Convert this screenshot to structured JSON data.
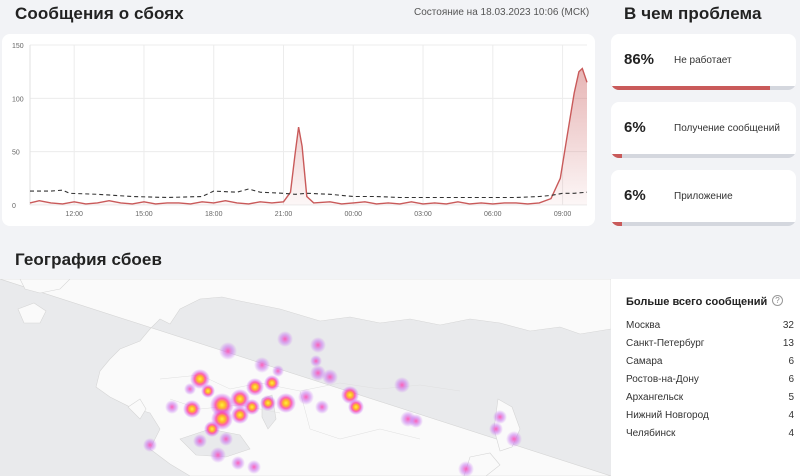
{
  "header": {
    "reports_title": "Сообщения о сбоях",
    "status_text": "Состояние на 18.03.2023 10:06 (МСК)",
    "problem_title": "В чем проблема",
    "geo_title": "География сбоев"
  },
  "chart_data": {
    "type": "line",
    "x_tick_labels": [
      "12:00",
      "15:00",
      "18:00",
      "21:00",
      "00:00",
      "03:00",
      "06:00",
      "09:00"
    ],
    "y_tick_labels": [
      "0",
      "50",
      "100",
      "150"
    ],
    "ylim": [
      0,
      150
    ],
    "x_start_hour": 10.1,
    "x_end_hour": 34.05,
    "series": [
      {
        "style": "solid-area",
        "color": "#c95a5a",
        "points": [
          [
            10.1,
            2
          ],
          [
            10.5,
            4
          ],
          [
            11,
            2
          ],
          [
            11.5,
            1
          ],
          [
            12,
            3
          ],
          [
            12.5,
            1
          ],
          [
            13,
            2
          ],
          [
            13.5,
            4
          ],
          [
            14,
            2
          ],
          [
            14.5,
            1
          ],
          [
            15,
            3
          ],
          [
            15.5,
            1
          ],
          [
            16,
            2
          ],
          [
            16.5,
            2
          ],
          [
            17,
            1
          ],
          [
            17.5,
            3
          ],
          [
            18,
            2
          ],
          [
            18.5,
            4
          ],
          [
            19,
            2
          ],
          [
            19.5,
            1
          ],
          [
            20,
            3
          ],
          [
            20.5,
            2
          ],
          [
            21,
            3
          ],
          [
            21.3,
            12
          ],
          [
            21.5,
            48
          ],
          [
            21.65,
            73
          ],
          [
            21.8,
            55
          ],
          [
            22,
            8
          ],
          [
            22.3,
            2
          ],
          [
            23,
            3
          ],
          [
            23.5,
            1
          ],
          [
            24,
            2
          ],
          [
            24.5,
            3
          ],
          [
            25,
            1
          ],
          [
            25.5,
            2
          ],
          [
            26,
            1
          ],
          [
            26.5,
            3
          ],
          [
            27,
            1
          ],
          [
            27.5,
            2
          ],
          [
            28,
            1
          ],
          [
            28.5,
            3
          ],
          [
            29,
            1
          ],
          [
            29.5,
            2
          ],
          [
            30,
            1
          ],
          [
            30.5,
            2
          ],
          [
            31,
            2
          ],
          [
            31.5,
            1
          ],
          [
            32,
            2
          ],
          [
            32.5,
            6
          ],
          [
            32.9,
            25
          ],
          [
            33.2,
            65
          ],
          [
            33.5,
            105
          ],
          [
            33.7,
            125
          ],
          [
            33.85,
            128
          ],
          [
            34.05,
            115
          ]
        ]
      },
      {
        "style": "dashed",
        "color": "#333333",
        "points": [
          [
            10.1,
            13
          ],
          [
            11,
            13
          ],
          [
            11.5,
            14
          ],
          [
            11.8,
            11
          ],
          [
            13,
            10
          ],
          [
            14.5,
            8
          ],
          [
            16,
            7
          ],
          [
            17.5,
            8
          ],
          [
            18,
            13
          ],
          [
            19,
            12
          ],
          [
            19.5,
            15
          ],
          [
            20,
            12
          ],
          [
            21,
            11
          ],
          [
            21.5,
            10
          ],
          [
            22,
            11
          ],
          [
            23,
            10
          ],
          [
            24,
            8
          ],
          [
            25,
            8
          ],
          [
            26,
            7
          ],
          [
            27,
            7
          ],
          [
            28,
            7
          ],
          [
            29,
            7
          ],
          [
            30,
            7
          ],
          [
            31,
            7
          ],
          [
            32,
            8
          ],
          [
            32.5,
            9
          ],
          [
            33,
            11
          ],
          [
            33.5,
            11
          ],
          [
            34.05,
            12
          ]
        ]
      }
    ]
  },
  "problems": [
    {
      "percent": "86%",
      "label": "Не работает",
      "fill": 86
    },
    {
      "percent": "6%",
      "label": "Получение сообщений",
      "fill": 6
    },
    {
      "percent": "6%",
      "label": "Приложение",
      "fill": 6
    }
  ],
  "top_list": {
    "title": "Больше всего сообщений",
    "help_icon": "help-circle-icon",
    "rows": [
      {
        "city": "Москва",
        "count": "32"
      },
      {
        "city": "Санкт-Петербург",
        "count": "13"
      },
      {
        "city": "Самара",
        "count": "6"
      },
      {
        "city": "Ростов-на-Дону",
        "count": "6"
      },
      {
        "city": "Архангельск",
        "count": "5"
      },
      {
        "city": "Нижний Новгород",
        "count": "4"
      },
      {
        "city": "Челябинск",
        "count": "4"
      }
    ]
  },
  "colors": {
    "accent": "#c95a5a",
    "track": "#d4d7de",
    "background": "#f2f3f6"
  }
}
